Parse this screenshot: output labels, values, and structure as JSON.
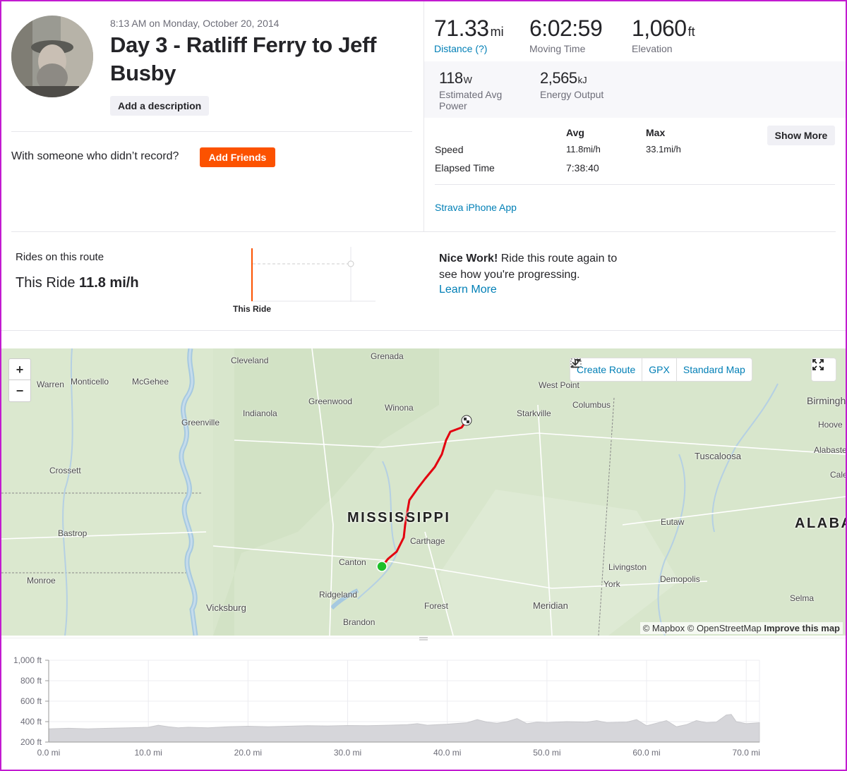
{
  "activity": {
    "date": "8:13 AM on Monday, October 20, 2014",
    "title": "Day 3 - Ratliff Ferry to Jeff Busby",
    "add_description": "Add a description",
    "with_someone": "With someone who didn’t record?",
    "add_friends": "Add Friends"
  },
  "stats": {
    "distance": {
      "value": "71.33",
      "unit": "mi",
      "label": "Distance (?)"
    },
    "moving_time": {
      "value": "6:02:59",
      "label": "Moving Time"
    },
    "elevation": {
      "value": "1,060",
      "unit": "ft",
      "label": "Elevation"
    },
    "power": {
      "value": "118",
      "unit": "W",
      "label": "Estimated Avg Power"
    },
    "energy": {
      "value": "2,565",
      "unit": "kJ",
      "label": "Energy Output"
    }
  },
  "table": {
    "col_avg": "Avg",
    "col_max": "Max",
    "show_more": "Show More",
    "speed_label": "Speed",
    "speed_avg": "11.8mi/h",
    "speed_max": "33.1mi/h",
    "elapsed_label": "Elapsed Time",
    "elapsed_avg": "7:38:40"
  },
  "device": "Strava iPhone App",
  "route": {
    "rides_label": "Rides on this route",
    "this_ride_label": "This Ride",
    "this_ride_value": "11.8 mi/h",
    "chart_label": "This Ride",
    "nice_bold": "Nice Work!",
    "nice_rest": " Ride this route again to see how you're progressing.",
    "learn_more": "Learn More"
  },
  "map": {
    "zoom_in": "+",
    "zoom_out": "−",
    "create_route": "Create Route",
    "gpx": "GPX",
    "standard_map": "Standard Map",
    "attribution_prefix": "© Mapbox © OpenStreetMap",
    "attribution_link": "Improve this map",
    "state_ms": "MISSISSIPPI",
    "state_al": "ALABA",
    "towns": {
      "cleveland": "Cleveland",
      "grenada": "Grenada",
      "warren": "Warren",
      "monticello": "Monticello",
      "mcgehee": "McGehee",
      "greenwood": "Greenwood",
      "indianola": "Indianola",
      "greenville": "Greenville",
      "winona": "Winona",
      "west_point": "West Point",
      "columbus": "Columbus",
      "starkville": "Starkville",
      "birmingham": "Birmingh",
      "hoover": "Hoove",
      "alabaster": "Alabaste",
      "calera": "Cale",
      "tuscaloosa": "Tuscaloosa",
      "crossett": "Crossett",
      "bastrop": "Bastrop",
      "carthage": "Carthage",
      "canton": "Canton",
      "eutaw": "Eutaw",
      "monroe": "Monroe",
      "ridgeland": "Ridgeland",
      "livingston": "Livingston",
      "york": "York",
      "demopolis": "Demopolis",
      "vicksburg": "Vicksburg",
      "forest": "Forest",
      "meridian": "Meridian",
      "selma": "Selma",
      "brandon": "Brandon"
    }
  },
  "colors": {
    "brand": "#fc5200",
    "link": "#007fb6",
    "route": "#e3000f",
    "start": "#1fbf2a"
  },
  "chart_data": {
    "type": "area",
    "title": "",
    "xlabel": "",
    "ylabel": "",
    "x_ticks": [
      "0.0 mi",
      "10.0 mi",
      "20.0 mi",
      "30.0 mi",
      "40.0 mi",
      "50.0 mi",
      "60.0 mi",
      "70.0 mi"
    ],
    "y_ticks": [
      "1,000 ft",
      "800 ft",
      "600 ft",
      "400 ft",
      "200 ft"
    ],
    "xlim": [
      0,
      71.33
    ],
    "ylim": [
      200,
      1000
    ],
    "grid": true,
    "x": [
      0,
      2,
      4,
      6,
      8,
      10,
      11,
      12,
      13,
      14,
      16,
      18,
      20,
      22,
      24,
      26,
      28,
      30,
      32,
      34,
      36,
      37,
      38,
      39,
      40,
      42,
      43,
      44,
      45,
      46,
      47,
      48,
      49,
      50,
      52,
      54,
      55,
      56,
      58,
      59,
      60,
      61,
      62,
      63,
      64,
      65,
      66,
      67,
      68,
      68.5,
      69,
      70,
      71.33
    ],
    "y": [
      330,
      335,
      330,
      335,
      340,
      345,
      365,
      350,
      340,
      345,
      340,
      350,
      355,
      350,
      355,
      360,
      358,
      362,
      360,
      365,
      370,
      380,
      365,
      370,
      375,
      390,
      420,
      395,
      385,
      400,
      430,
      380,
      395,
      390,
      400,
      395,
      410,
      390,
      395,
      420,
      360,
      385,
      410,
      350,
      370,
      410,
      390,
      395,
      465,
      470,
      400,
      380,
      390
    ]
  }
}
